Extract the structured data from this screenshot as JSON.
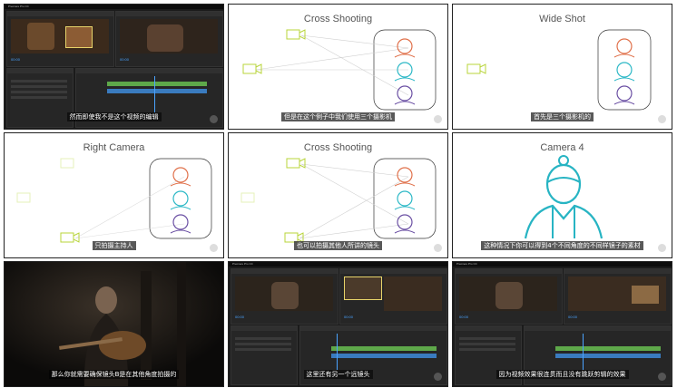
{
  "panels": [
    {
      "id": "p1",
      "kind": "premiere",
      "subtitle": "然而即使我不是这个视频的编辑"
    },
    {
      "id": "p2",
      "kind": "diagram",
      "title": "Cross Shooting",
      "subtitle": "但是在这个例子中我们使用三个摄影机"
    },
    {
      "id": "p3",
      "kind": "diagram",
      "title": "Wide Shot",
      "subtitle": "首先是三个摄影机的"
    },
    {
      "id": "p4",
      "kind": "diagram",
      "title": "Right Camera",
      "subtitle": "只拍摄主持人"
    },
    {
      "id": "p5",
      "kind": "diagram",
      "title": "Cross Shooting",
      "subtitle": "也可以拍摄其他人所讲的镜头"
    },
    {
      "id": "p6",
      "kind": "diagram",
      "title": "Camera 4",
      "subtitle": "这种情况下你可以得到4个不同角度的不同样镜子的素材"
    },
    {
      "id": "p7",
      "kind": "photo",
      "subtitle": "那么你就需要确保镜头B是在其他角度拍摄的"
    },
    {
      "id": "p8",
      "kind": "premiere",
      "subtitle": "这里还有另一个远镜头"
    },
    {
      "id": "p9",
      "kind": "premiere",
      "subtitle": "因为视频效果很连贯而且没有跳跃剪辑的效果"
    }
  ],
  "premiere": {
    "app_title": "Premiere Pro CC",
    "menu": [
      "File",
      "Edit",
      "Clip",
      "Sequence",
      "Marker",
      "Title",
      "Window",
      "Help"
    ],
    "timecode_left": "00:00",
    "timecode_right": "00:00"
  },
  "colors": {
    "camera_green": "#b8d43a",
    "person_orange": "#e0704a",
    "person_teal": "#2cb8c6",
    "person_purple": "#6a4fa3",
    "camera4_teal": "#27b4c3",
    "diagram_line": "#cfcfcf",
    "timeline_green": "#5ea84a",
    "timeline_blue": "#3a7bbf"
  },
  "icons": {
    "camera": "video-camera-icon",
    "person": "person-icon",
    "settings": "round-settings-icon"
  }
}
